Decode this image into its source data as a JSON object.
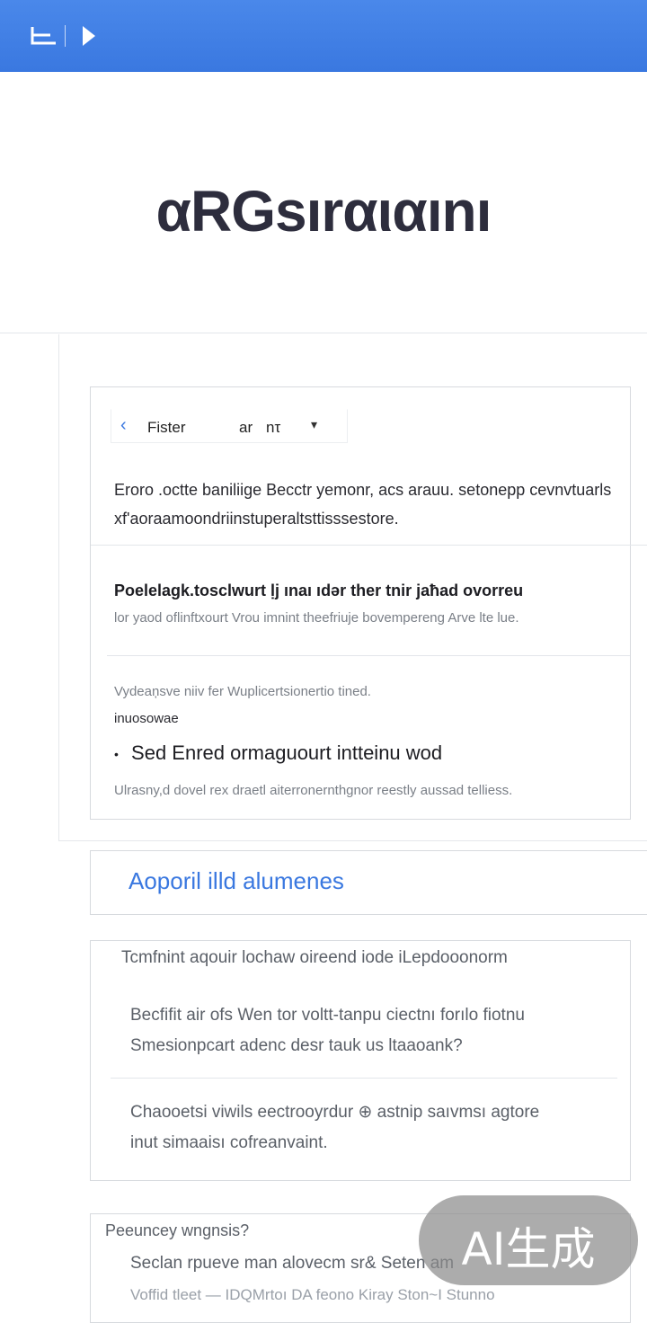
{
  "brand": {
    "topbar": "#3d7ce2",
    "accent": "#3a78e0"
  },
  "topbar": {
    "left_icon": "panel-icon",
    "right_icon": "play-arrow-icon"
  },
  "logo": {
    "text": "αRGsırαιαını"
  },
  "filter": {
    "back_icon": "chevron-left-icon",
    "label": "Fister",
    "sub": "ar",
    "value": "nτ",
    "caret_icon": "caret-down-icon"
  },
  "intro": {
    "text": "Eroro .octte baniliige Becctr yemonr, acs arauu. setonepp cevnvtuarls xf'aoraamoondriinstuperaltsttisssestore."
  },
  "section2": {
    "title": "Poelelagk.tosclwurt ḷj ınaı ıdǝr ther tnir jaħad ovorreu",
    "subtitle": "lor yaod oflinftxourt Vrou imnint theefriuje bovempereng Arve lte lue."
  },
  "section3": {
    "line": "Vydeaņsve niiv fer Wuplicertsionertio tined.",
    "label": "inuosowae",
    "bullet": "Sed Enred ormaguourt intteinu wod",
    "footnote": "Ulrasny,d dovel rex draetl aiterronernthgnor reestly aussad telliess."
  },
  "section_header": {
    "title": "Aoporil illd alumenes"
  },
  "card2": {
    "title": "Tcmfnint aqouir lochaw oireend iode iLepdooonorm",
    "para1": "Becfifit air ofs Wen tor voltt-tanpu ciectnı forılo fiotnu",
    "para1b": "Smesionpcart adenc desr tauk us ltaaoank?",
    "para2": "Chaooetsi viwils eectrooyrdur ⊕ astnip saıvmsı agtore",
    "para2b": "inut simaaisı cofreanvaint."
  },
  "card3": {
    "title": "Peeuncey wngnsis?",
    "para": "Seclan rpueve man alovecm sr& Seten am",
    "para2": "Voffid tleet — IDQMrtoı DA feono Kiray Ston~I Stunno"
  },
  "watermark": {
    "text": "AI生成"
  }
}
